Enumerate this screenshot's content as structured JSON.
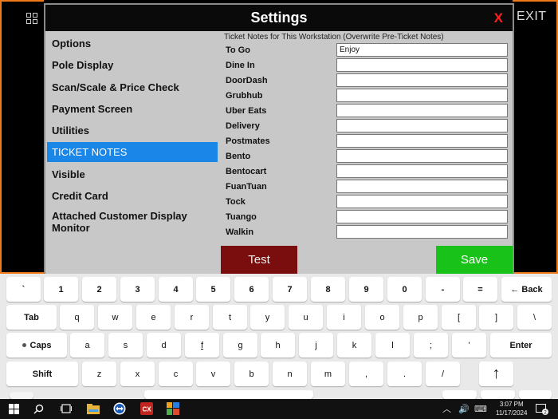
{
  "app": {
    "exit_label": "EXIT"
  },
  "settings": {
    "title": "Settings",
    "close_label": "X",
    "menu": [
      {
        "label": "Options"
      },
      {
        "label": "Pole Display"
      },
      {
        "label": "Scan/Scale & Price Check"
      },
      {
        "label": "Payment Screen"
      },
      {
        "label": "Utilities"
      },
      {
        "label": "TICKET NOTES",
        "active": true
      },
      {
        "label": "Visible"
      },
      {
        "label": "Credit Card"
      },
      {
        "label": "Attached Customer Display Monitor"
      }
    ],
    "notes_heading": "Ticket Notes for This Workstation (Overwrite Pre-Ticket Notes)",
    "notes": [
      {
        "label": "To Go",
        "value": "Enjoy"
      },
      {
        "label": "Dine In",
        "value": ""
      },
      {
        "label": "DoorDash",
        "value": ""
      },
      {
        "label": "Grubhub",
        "value": ""
      },
      {
        "label": "Uber Eats",
        "value": ""
      },
      {
        "label": "Delivery",
        "value": ""
      },
      {
        "label": "Postmates",
        "value": ""
      },
      {
        "label": "Bento",
        "value": ""
      },
      {
        "label": "Bentocart",
        "value": ""
      },
      {
        "label": "FuanTuan",
        "value": ""
      },
      {
        "label": "Tock",
        "value": ""
      },
      {
        "label": "Tuango",
        "value": ""
      },
      {
        "label": "Walkin",
        "value": ""
      }
    ],
    "test_label": "Test",
    "save_label": "Save"
  },
  "keyboard": {
    "row1": [
      "`",
      "1",
      "2",
      "3",
      "4",
      "5",
      "6",
      "7",
      "8",
      "9",
      "0",
      "-",
      "=",
      "← Back"
    ],
    "row2": [
      "Tab",
      "q",
      "w",
      "e",
      "r",
      "t",
      "y",
      "u",
      "i",
      "o",
      "p",
      "[",
      "]",
      "\\"
    ],
    "row3": [
      "Caps",
      "a",
      "s",
      "d",
      "f",
      "g",
      "h",
      "j",
      "k",
      "l",
      ";",
      "'",
      "Enter"
    ],
    "row4": [
      "Shift",
      "z",
      "x",
      "c",
      "v",
      "b",
      "n",
      "m",
      ",",
      ".",
      "/",
      "↑"
    ]
  },
  "taskbar": {
    "time": "3:07 PM",
    "date": "11/17/2024",
    "notification_count": "2",
    "icons": [
      "windows-start-icon",
      "search-icon",
      "task-view-icon",
      "file-explorer-icon",
      "teamviewer-icon",
      "pos-app-icon",
      "store-app-icon"
    ]
  },
  "colors": {
    "accent_selected": "#1a86e8",
    "save_green": "#19c219",
    "test_red": "#7a0d0d",
    "close_red": "#ff2020",
    "frame_orange": "#f07a1a"
  }
}
